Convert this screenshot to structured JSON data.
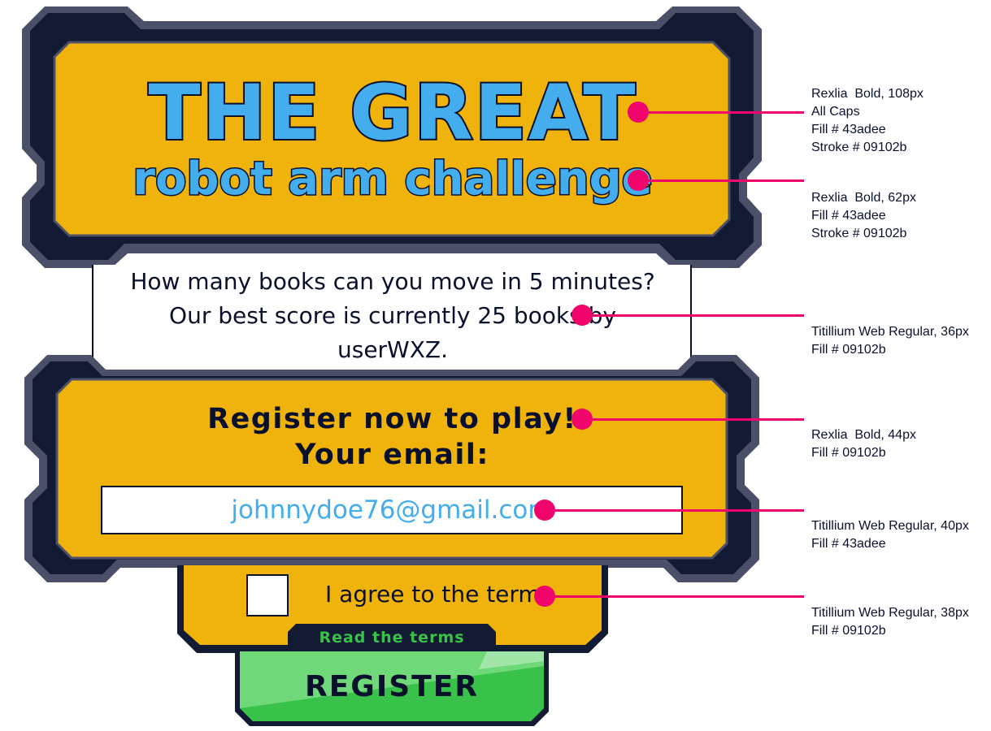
{
  "title": {
    "line1": "THE GREAT",
    "line2": "robot arm challenge"
  },
  "description": {
    "text": "How many books can you move in 5 minutes? Our best score is currently 25 books by userWXZ."
  },
  "register_panel": {
    "heading": "Register now to play!",
    "email_label": "Your email:",
    "email_value": "johnnydoe76@gmail.com"
  },
  "terms": {
    "checkbox_checked": false,
    "label": "I agree to the terms",
    "read_link": "Read the terms"
  },
  "register_button": {
    "label": "REGISTER"
  },
  "annotations": [
    {
      "lines": [
        "Rexlia  Bold, 108px",
        "All Caps",
        "Fill # 43adee",
        "Stroke # 09102b"
      ]
    },
    {
      "lines": [
        "Rexlia  Bold, 62px",
        "Fill # 43adee",
        "Stroke # 09102b"
      ]
    },
    {
      "lines": [
        "Titillium Web Regular, 36px",
        "Fill # 09102b"
      ]
    },
    {
      "lines": [
        "Rexlia  Bold, 44px",
        "Fill # 09102b"
      ]
    },
    {
      "lines": [
        "Titillium Web Regular, 40px",
        "Fill # 43adee"
      ]
    },
    {
      "lines": [
        "Titillium Web Regular, 38px",
        "Fill # 09102b"
      ]
    }
  ],
  "colors": {
    "panel_fill": "#f0b30c",
    "frame_dark": "#131a33",
    "frame_mid": "#4b5068",
    "text_dark": "#09102b",
    "accent_blue": "#43adee",
    "callout_pink": "#f0046c",
    "button_green": "#39c24a"
  }
}
